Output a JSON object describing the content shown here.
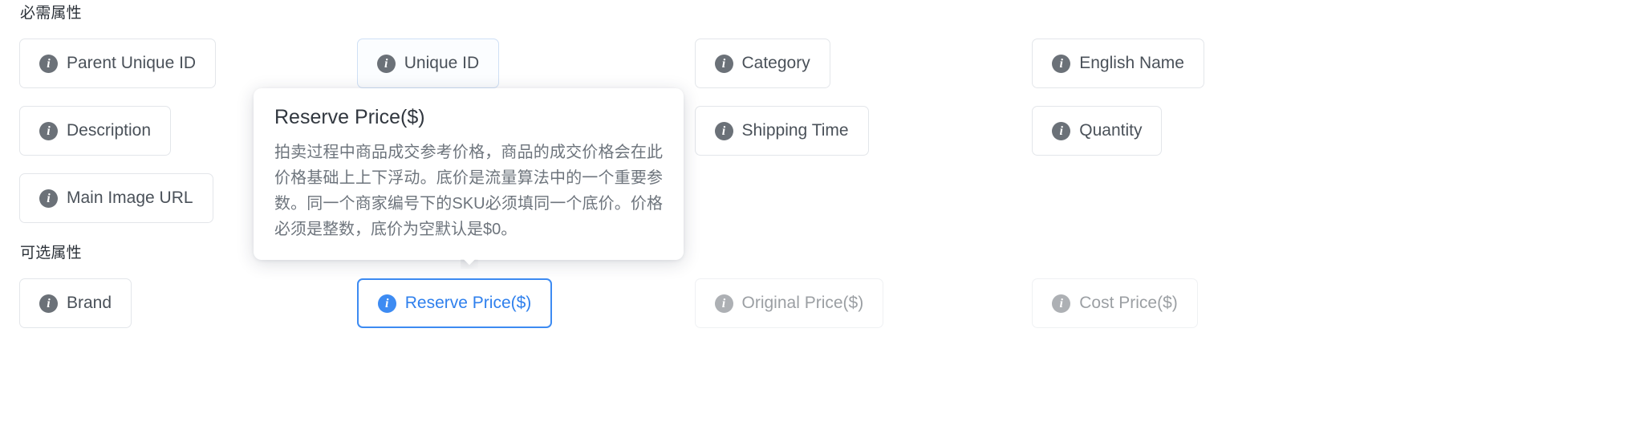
{
  "sections": {
    "required": {
      "heading": "必需属性",
      "items": [
        {
          "label": "Parent Unique ID",
          "icon": "info-icon",
          "state": "default"
        },
        {
          "label": "Unique ID",
          "icon": "info-icon",
          "state": "soft"
        },
        {
          "label": "Category",
          "icon": "info-icon",
          "state": "default"
        },
        {
          "label": "English Name",
          "icon": "info-icon",
          "state": "default"
        },
        {
          "label": "Description",
          "icon": "info-icon",
          "state": "default"
        },
        {
          "label": "",
          "icon": "",
          "state": "empty"
        },
        {
          "label": "Shipping Time",
          "icon": "info-icon",
          "state": "default"
        },
        {
          "label": "Quantity",
          "icon": "info-icon",
          "state": "default"
        },
        {
          "label": "Main Image URL",
          "icon": "info-icon",
          "state": "default"
        }
      ]
    },
    "optional": {
      "heading": "可选属性",
      "items": [
        {
          "label": "Brand",
          "icon": "info-icon",
          "state": "default"
        },
        {
          "label": "Reserve Price($)",
          "icon": "info-icon",
          "state": "active"
        },
        {
          "label": "Original Price($)",
          "icon": "info-icon",
          "state": "default"
        },
        {
          "label": "Cost Price($)",
          "icon": "info-icon",
          "state": "default"
        }
      ]
    }
  },
  "tooltip": {
    "title": "Reserve Price($)",
    "body": "拍卖过程中商品成交参考价格，商品的成交价格会在此价格基础上上下浮动。底价是流量算法中的一个重要参数。同一个商家编号下的SKU必须填同一个底价。价格必须是整数，底价为空默认是$0。"
  },
  "icons": {
    "info_glyph": "i"
  },
  "colors": {
    "accent": "#3d8bf2",
    "accent_text": "#2f80ed",
    "badge": "#6b7178",
    "border": "#e3e6ea",
    "text": "#4a5159",
    "muted_text": "#6d747c",
    "background": "#ffffff"
  }
}
